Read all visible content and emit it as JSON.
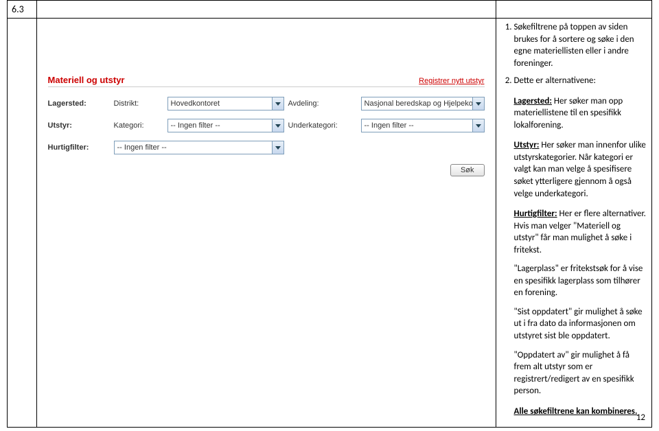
{
  "section_number": "6.3",
  "page_number": "12",
  "instructions": {
    "item1": "Søkefiltrene på toppen av siden brukes for å sortere og søke i den egne materiellisten eller i andre foreninger.",
    "item2_intro": "Dette er alternativene:",
    "lagersted_label": "Lagersted:",
    "lagersted_text": " Her søker man opp materiellistene til en spesifikk lokalforening.",
    "utstyr_label": "Utstyr:",
    "utstyr_text": " Her søker man innenfor ulike utstyrskategorier. Når kategori er valgt kan man velge å spesifisere søket ytterligere gjennom å også velge underkategori.",
    "hurtigfilter_label": "Hurtigfilter:",
    "hurtigfilter_text": " Her er flere alternativer. Hvis man velger \"Materiell og utstyr\" får man mulighet å søke i fritekst.",
    "lagerplass_text": "\"Lagerplass\" er fritekstsøk for å vise en spesifikk lagerplass som tilhører en forening.",
    "sistoppdatert_text": "\"Sist oppdatert\" gir mulighet å søke ut i fra dato da informasjonen om utstyret sist ble oppdatert.",
    "oppdatertav_text": "\"Oppdatert av\" gir mulighet å få frem alt utstyr som er registrert/redigert av en spesifikk person.",
    "combine": "Alle søkefiltrene kan kombineres."
  },
  "panel": {
    "title": "Materiell og utstyr",
    "register_link": "Registrer nytt utstyr",
    "row1_label": "Lagersted:",
    "row1_sub1": "Distrikt:",
    "row1_val1": "Hovedkontoret",
    "row1_sub2": "Avdeling:",
    "row1_val2": "Nasjonal beredskap og Hjelpekorps",
    "row2_label": "Utstyr:",
    "row2_sub1": "Kategori:",
    "row2_val1": "-- Ingen filter --",
    "row2_sub2": "Underkategori:",
    "row2_val2": "-- Ingen filter --",
    "row3_label": "Hurtigfilter:",
    "row3_val": "-- Ingen filter --",
    "search_btn": "Søk"
  }
}
